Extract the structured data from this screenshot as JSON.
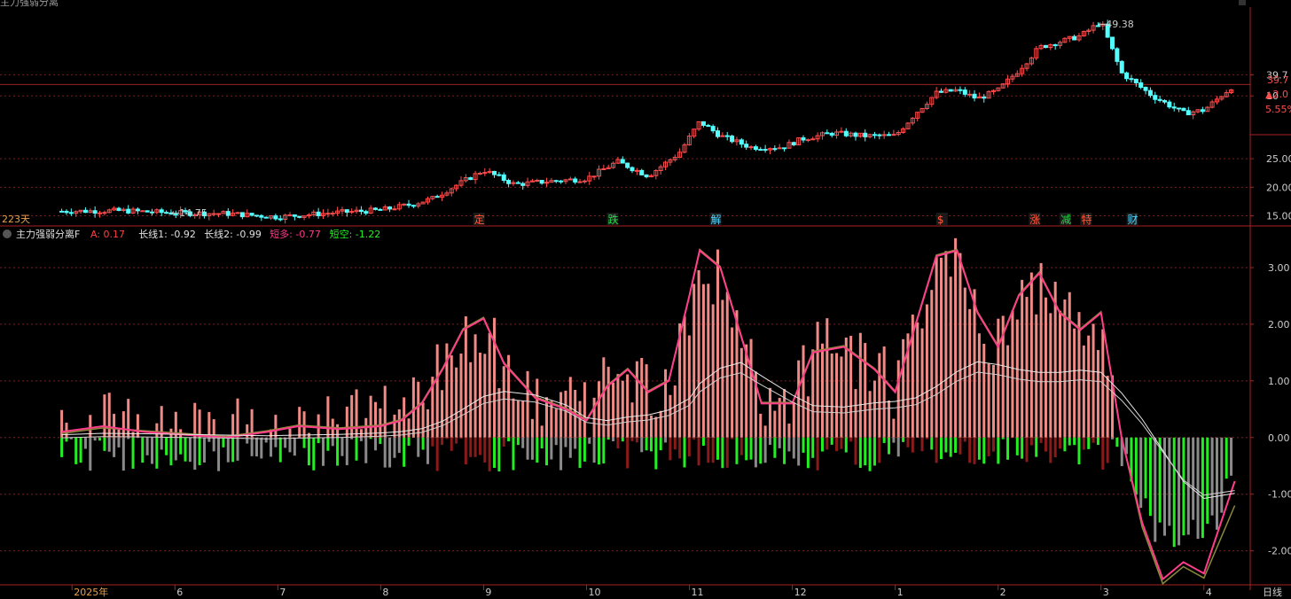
{
  "top_title": "主力强弱分离",
  "upper": {
    "price_ticks": [
      {
        "label": "39.7",
        "value": 39.7
      },
      {
        "label": "10",
        "value": 36.0
      },
      {
        "label": "25.00",
        "value": 25.0
      },
      {
        "label": "20.00",
        "value": 20.0
      },
      {
        "label": "15.00",
        "value": 15.0
      }
    ],
    "current_price": "39.7",
    "change_label": "▲2.0",
    "change_pct": "5.55%",
    "high_marker": "49.38",
    "low_marker": "14.75",
    "days_label": "223天",
    "events": [
      {
        "text": "定",
        "month": 8.95,
        "color": "#ff5a3c"
      },
      {
        "text": "跌",
        "month": 10.25,
        "color": "#22dd44"
      },
      {
        "text": "解",
        "month": 11.25,
        "color": "#4fd6ff"
      },
      {
        "text": "$",
        "month": 13.45,
        "color": "#ff5a3c"
      },
      {
        "text": "涨",
        "month": 14.35,
        "color": "#ff5a3c"
      },
      {
        "text": "减",
        "month": 14.65,
        "color": "#22dd44"
      },
      {
        "text": "特",
        "month": 14.85,
        "color": "#ff5a3c"
      },
      {
        "text": "财",
        "month": 15.3,
        "color": "#4fd6ff"
      }
    ]
  },
  "indicator": {
    "name": "主力强弱分离F",
    "items": [
      {
        "label": "A: 0.17",
        "color": "#ff4040"
      },
      {
        "label": "长线1: -0.92",
        "color": "#e0e0e0"
      },
      {
        "label": "长线2: -0.99",
        "color": "#e0e0e0"
      },
      {
        "label": "短多: -0.77",
        "color": "#ff3d8a"
      },
      {
        "label": "短空: -1.22",
        "color": "#22ee22"
      }
    ],
    "y_ticks": [
      "3.00",
      "2.00",
      "1.00",
      "0.00",
      "-1.00",
      "-2.00"
    ]
  },
  "x_axis": {
    "labels": [
      {
        "text": "2025年",
        "month": 5.0
      },
      {
        "text": "6",
        "month": 6.0
      },
      {
        "text": "7",
        "month": 7.0
      },
      {
        "text": "8",
        "month": 8.0
      },
      {
        "text": "9",
        "month": 9.0
      },
      {
        "text": "10",
        "month": 10.0
      },
      {
        "text": "11",
        "month": 11.0
      },
      {
        "text": "12",
        "month": 12.0
      },
      {
        "text": "1",
        "month": 13.0
      },
      {
        "text": "2",
        "month": 14.0
      },
      {
        "text": "3",
        "month": 15.0
      },
      {
        "text": "4",
        "month": 16.0
      }
    ],
    "period_label": "日线"
  },
  "colors": {
    "up": "#ff4d4d",
    "down": "#54ffff",
    "pos_bar": "#f08a86",
    "neg_dark": "#8b1a1a",
    "neg_green": "#22ee22",
    "grey": "#8a8a8a",
    "grid": "#7a1f1f"
  },
  "chart_data": [
    {
      "type": "line",
      "title": "",
      "x_unit": "month index (5 = 2025-05, 13 = 2026-01)",
      "series": [
        {
          "name": "",
          "x": [
            4.9,
            5.5,
            6.0,
            6.5,
            7.0,
            7.5,
            8.0,
            8.3,
            8.5,
            8.8,
            9.0,
            9.3,
            9.6,
            10.0,
            10.3,
            10.6,
            10.9,
            11.1,
            11.3,
            11.6,
            11.9,
            12.1,
            12.4,
            12.7,
            13.0,
            13.2,
            13.4,
            13.6,
            13.8,
            14.0,
            14.2,
            14.4,
            14.6,
            14.8,
            15.0,
            15.2,
            15.5,
            15.8,
            16.0,
            16.3
          ],
          "values": [
            15.8,
            15.9,
            15.5,
            15.4,
            14.8,
            15.5,
            16.0,
            17.0,
            18.0,
            21.0,
            23.0,
            20.5,
            21.0,
            21.5,
            24.5,
            22.0,
            26.0,
            31.5,
            29.0,
            27.0,
            27.0,
            28.5,
            29.5,
            29.0,
            29.0,
            33.0,
            36.5,
            37.0,
            35.5,
            37.0,
            40.5,
            44.5,
            45.5,
            46.5,
            49.0,
            40.0,
            36.0,
            33.0,
            33.5,
            38.0
          ]
        }
      ],
      "ylim": [
        14,
        50
      ]
    },
    {
      "type": "bar",
      "title": "",
      "x_unit": "month index",
      "x": [
        4.9,
        5.3,
        5.7,
        6.1,
        6.5,
        6.9,
        7.2,
        7.6,
        8.0,
        8.2,
        8.4,
        8.6,
        8.8,
        9.0,
        9.2,
        9.5,
        9.8,
        10.0,
        10.2,
        10.4,
        10.6,
        10.8,
        11.0,
        11.1,
        11.3,
        11.5,
        11.7,
        12.0,
        12.2,
        12.5,
        12.8,
        13.0,
        13.2,
        13.4,
        13.6,
        13.8,
        14.0,
        14.2,
        14.4,
        14.6,
        14.8,
        15.0,
        15.2,
        15.4,
        15.6,
        15.8,
        16.0,
        16.3
      ],
      "series": [
        {
          "name": "短多",
          "values": [
            0.1,
            0.2,
            0.1,
            0.05,
            0.0,
            0.1,
            0.2,
            0.15,
            0.2,
            0.3,
            0.6,
            1.2,
            1.9,
            2.1,
            1.3,
            0.7,
            0.5,
            0.3,
            0.9,
            1.2,
            0.8,
            1.0,
            2.5,
            3.3,
            3.0,
            1.8,
            0.6,
            0.6,
            1.5,
            1.6,
            1.2,
            0.8,
            2.0,
            3.2,
            3.3,
            2.2,
            1.6,
            2.5,
            2.9,
            2.2,
            1.9,
            2.2,
            0.0,
            -1.5,
            -2.5,
            -2.2,
            -2.4,
            -0.77
          ]
        },
        {
          "name": "短空",
          "values": [
            0.05,
            0.15,
            0.1,
            0.05,
            0.0,
            0.1,
            0.2,
            0.15,
            0.2,
            0.3,
            0.6,
            1.2,
            1.9,
            2.1,
            1.3,
            0.7,
            0.5,
            0.3,
            0.9,
            1.2,
            0.8,
            1.0,
            2.5,
            3.3,
            3.0,
            1.8,
            0.6,
            0.6,
            1.5,
            1.6,
            1.2,
            0.8,
            2.0,
            3.2,
            3.3,
            2.2,
            1.6,
            2.5,
            2.9,
            2.2,
            1.9,
            2.2,
            0.0,
            -1.6,
            -2.6,
            -2.3,
            -2.5,
            -1.22
          ]
        }
      ],
      "ylim": [
        -2.6,
        3.5
      ]
    }
  ]
}
